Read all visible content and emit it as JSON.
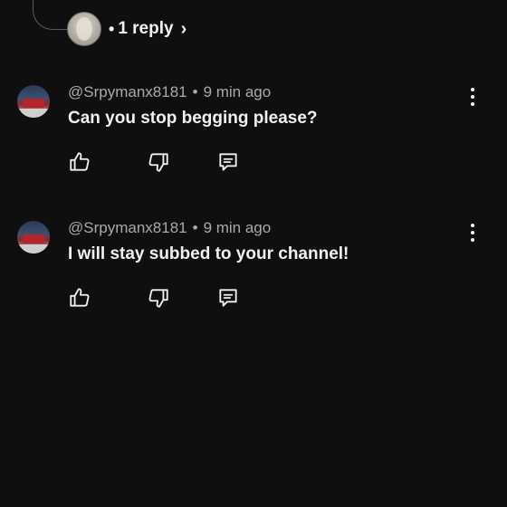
{
  "reply_summary": {
    "label": "1 reply",
    "dot": "•",
    "chevron": "›"
  },
  "comments": [
    {
      "author": "@Srpymanx8181",
      "separator": "•",
      "time": "9 min ago",
      "text": "Can you stop begging please?"
    },
    {
      "author": "@Srpymanx8181",
      "separator": "•",
      "time": "9 min ago",
      "text": "I will stay subbed to your channel!"
    }
  ],
  "icons": {
    "like": "thumbs-up-icon",
    "dislike": "thumbs-down-icon",
    "reply": "comment-icon",
    "more": "more-vertical-icon"
  },
  "colors": {
    "background": "#0f0f0f",
    "text": "#f1f1f1",
    "meta": "#aaaaaa"
  }
}
